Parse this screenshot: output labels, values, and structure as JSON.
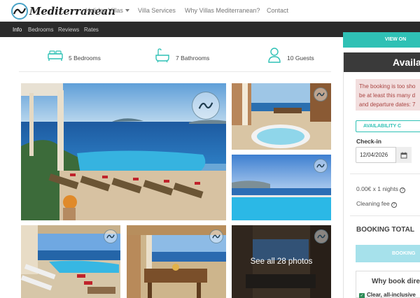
{
  "nav": {
    "logo_text": "Mediterranean",
    "links": [
      "Holiday Villas",
      "Villa Services",
      "Why Villas Mediterranean?",
      "Contact"
    ]
  },
  "subnav": {
    "items": [
      "Info",
      "Bedrooms",
      "Reviews",
      "Rates"
    ],
    "active": "Info"
  },
  "amenities": {
    "bedrooms": "5 Bedrooms",
    "bathrooms": "7 Bathrooms",
    "guests": "10 Guests"
  },
  "gallery": {
    "see_all": "See all 28 photos",
    "photo_count": 5
  },
  "sidebar": {
    "view_button": "VIEW ON",
    "availability_title": "Availa",
    "alert_lines": [
      "The booking is too sho",
      "be at least this many d",
      "and departure dates: 7"
    ],
    "availability_button": "AVAILABILITY C",
    "checkin_label": "Check-in",
    "checkin_value": "12/04/2026",
    "price_line": "0.00€ x 1 nights",
    "cleaning_fee": "Cleaning fee",
    "total_label": "BOOKING TOTAL",
    "booking_button": "BOOKING",
    "why_title": "Why book dire",
    "why_item": "Clear, all-inclusive"
  },
  "colors": {
    "teal": "#2fc1b5",
    "dark_bar": "#2b2b2b",
    "alert_bg": "#f2dede",
    "alert_text": "#a94442",
    "booking_btn": "#a6e1eb"
  }
}
